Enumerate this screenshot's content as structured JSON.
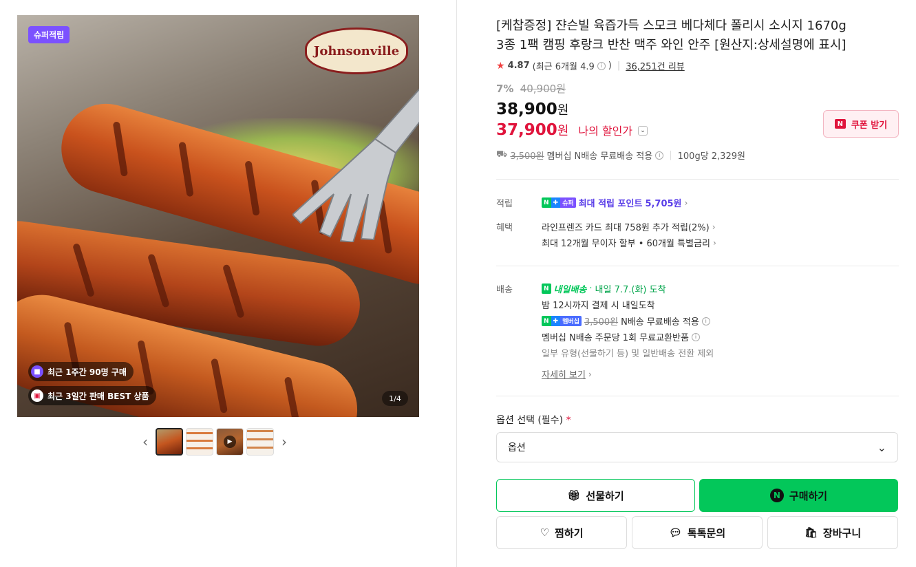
{
  "gallery": {
    "badge": "슈퍼적립",
    "logo_text": "Johnsonville",
    "pill_week": "최근 1주간 90명 구매",
    "pill_best": "최근 3일간 판매 BEST 상품",
    "pager": "1/4"
  },
  "product": {
    "title_line1": "[케찹증정] 쟌슨빌 육즙가득 스모크 베다체다 폴리시 소시지 1670g",
    "title_line2": "3종 1팩 캠핑 후랑크 반찬 맥주 와인 안주 [원산지:상세설명에 표시]",
    "rating": "4.87",
    "rating_recent": "(최근 6개월 4.9",
    "review_count": "36,251건 리뷰",
    "discount_rate": "7%",
    "original_price": "40,900원",
    "price": "38,900",
    "my_price": "37,900",
    "won": "원",
    "my_discount_label": "나의 할인가",
    "coupon_label": "쿠폰 받기",
    "ship_strike": "3,500원",
    "ship_text": "멤버십 N배송 무료배송 적용",
    "unit_price": "100g당 2,329원"
  },
  "benefits": {
    "points_label": "적립",
    "points_text": "최대 적립 포인트",
    "points_value": "5,705원",
    "benefit_label": "혜택",
    "card_text": "라인프렌즈 카드 최대 758원 추가 적립(2%)",
    "installment_text": "최대 12개월 무이자 할부 • 60개월 특별금리"
  },
  "delivery": {
    "label": "배송",
    "tomorrow_badge": "내일배송",
    "arrival": "내일 7.7.(화) 도착",
    "cutoff": "밤 12시까지 결제 시 내일도착",
    "member_strike": "3,500원",
    "member_text": "N배송 무료배송 적용",
    "exchange_text": "멤버십 N배송 주문당 1회 무료교환반품",
    "exclusion": "일부 유형(선물하기 등) 및 일반배송 전환 제외",
    "more": "자세히 보기"
  },
  "options": {
    "label": "옵션 선택 (필수)",
    "required_mark": "*",
    "selected": "옵션"
  },
  "actions": {
    "gift": "선물하기",
    "buy": "구매하기",
    "wish": "찜하기",
    "talk": "톡톡문의",
    "cart": "장바구니"
  },
  "colors": {
    "naver_green": "#03c75a",
    "sale_red": "#e0143c",
    "super_purple": "#7b51ff"
  }
}
